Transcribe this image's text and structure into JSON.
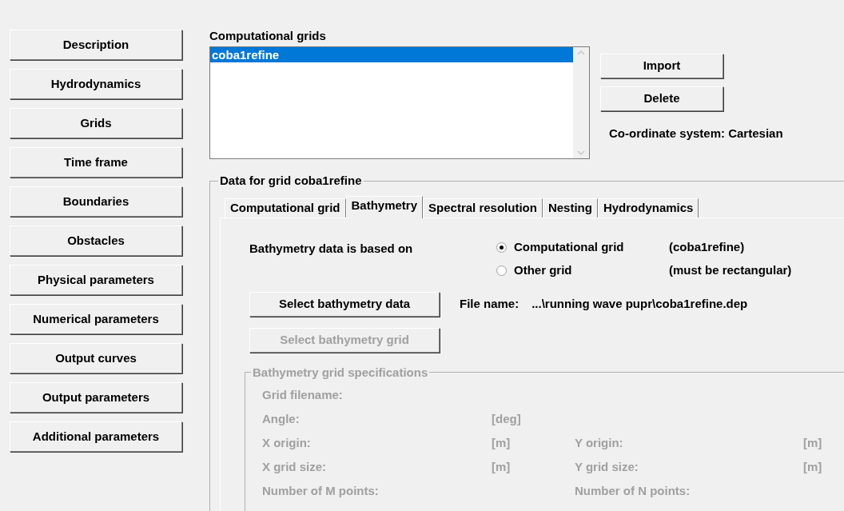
{
  "nav": [
    "Description",
    "Hydrodynamics",
    "Grids",
    "Time frame",
    "Boundaries",
    "Obstacles",
    "Physical parameters",
    "Numerical parameters",
    "Output curves",
    "Output parameters",
    "Additional parameters"
  ],
  "grids": {
    "title": "Computational grids",
    "items": [
      {
        "label": "coba1refine",
        "selected": true
      }
    ]
  },
  "grid_buttons": [
    "Import",
    "Delete"
  ],
  "coordinate_system": "Co-ordinate system:  Cartesian",
  "data_group": {
    "title": "Data for grid coba1refine",
    "tabs": [
      {
        "label": "Computational grid",
        "selected": false
      },
      {
        "label": "Bathymetry",
        "selected": true
      },
      {
        "label": "Spectral resolution",
        "selected": false
      },
      {
        "label": "Nesting",
        "selected": false
      },
      {
        "label": "Hydrodynamics",
        "selected": false
      }
    ],
    "based_on_label": "Bathymetry data is based on",
    "options": [
      {
        "label": "Computational grid",
        "note": "(coba1refine)",
        "selected": true
      },
      {
        "label": "Other grid",
        "note": "(must be rectangular)",
        "selected": false
      }
    ],
    "select_data_button": {
      "label": "Select bathymetry data",
      "disabled": false
    },
    "file_name_label": "File name:",
    "file_name": "...\\running wave pupr\\coba1refine.dep",
    "select_grid_button": {
      "label": "Select bathymetry grid",
      "disabled": true
    },
    "spec_group": {
      "title": "Bathymetry grid specifications",
      "disabled": true,
      "rows": [
        {
          "label": "Grid filename:"
        },
        {
          "label": "Angle:",
          "unit": "[deg]"
        },
        {
          "label": "X origin:",
          "unit": "[m]",
          "label_2": "Y origin:",
          "unit_2": "[m]"
        },
        {
          "label": "X grid size:",
          "unit": "[m]",
          "label_2": "Y grid size:",
          "unit_2": "[m]"
        },
        {
          "label": "Number of M points:",
          "label_2": "Number of N points:"
        }
      ]
    }
  }
}
